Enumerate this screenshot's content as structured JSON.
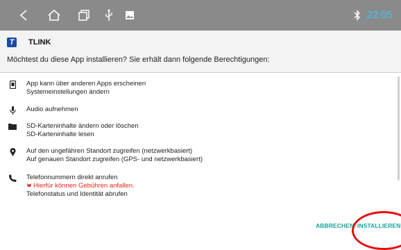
{
  "status_bar": {
    "icons": [
      "back-icon",
      "home-icon",
      "recents-icon",
      "usb-icon",
      "image-icon",
      "bluetooth-icon"
    ],
    "time": "22:05",
    "time_color": "#3fc3ee",
    "background": "#8a8a8a"
  },
  "app": {
    "icon_letter": "T",
    "name": "TLINK"
  },
  "prompt": "Möchtest du diese App installieren? Sie erhält dann folgende Berechtigungen:",
  "permissions": [
    {
      "icon": "overlay-icon",
      "lines": [
        "App kann über anderen Apps erscheinen",
        "Systemeinstellungen ändern"
      ]
    },
    {
      "icon": "microphone-icon",
      "lines": [
        "Audio aufnehmen"
      ]
    },
    {
      "icon": "folder-icon",
      "lines": [
        "SD-Karteninhalte ändern oder löschen",
        "SD-Karteninhalte lesen"
      ]
    },
    {
      "icon": "location-icon",
      "lines": [
        "Auf den ungefähren Standort zugreifen (netzwerkbasiert)",
        "Auf genauen Standort zugreifen (GPS- und netzwerkbasiert)"
      ]
    },
    {
      "icon": "phone-icon",
      "lines": [
        "Telefonnummern direkt anrufen",
        "Hierfür können Gebühren anfallen.",
        "Telefonstatus und Identität abrufen"
      ],
      "warning": "Hierfür können Gebühren anfallen."
    }
  ],
  "buttons": {
    "cancel": "ABBRECHEN",
    "install": "INSTALLIEREN"
  },
  "accent_color": "#1aa39a",
  "warning_color": "#e5261b",
  "highlight_circle_color": "#e21010"
}
